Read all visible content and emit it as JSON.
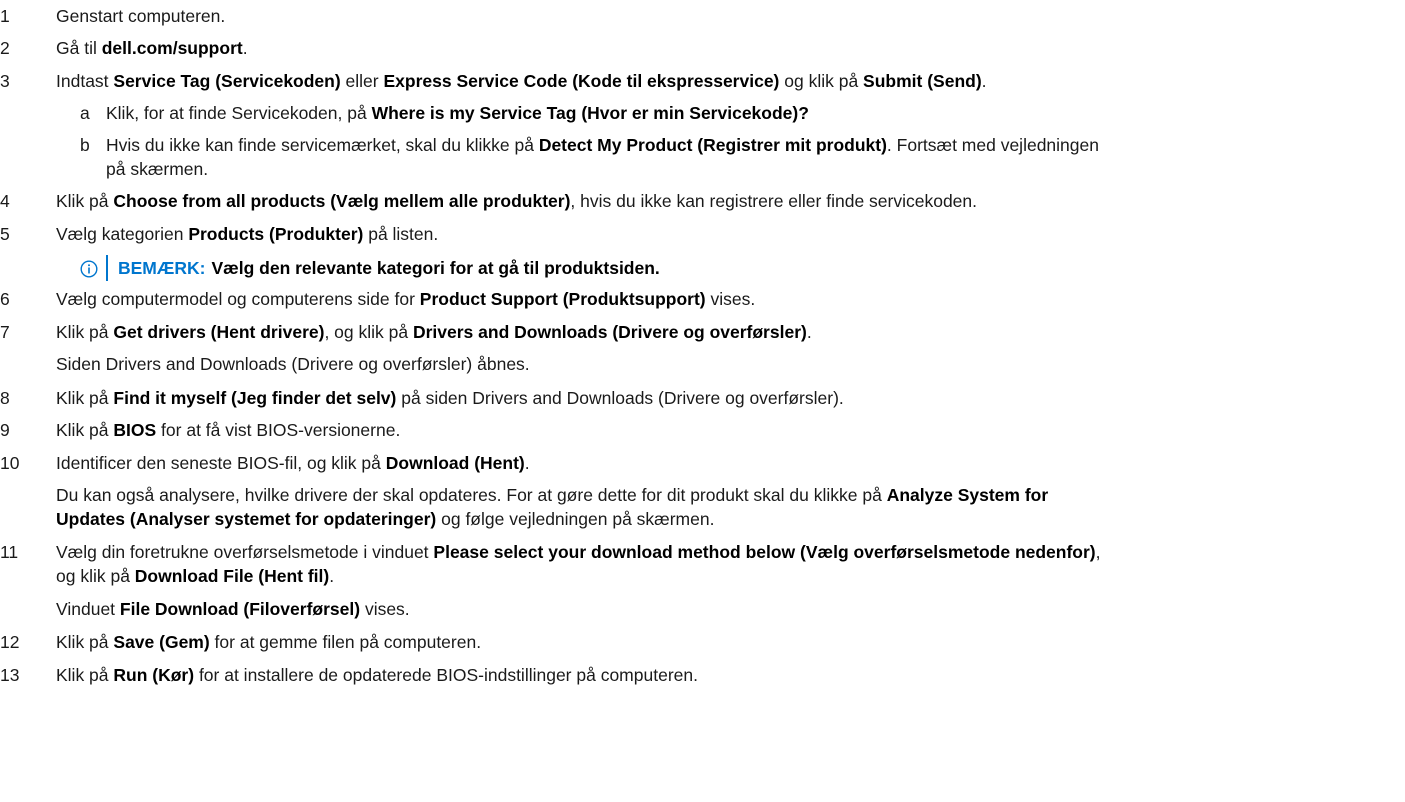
{
  "steps": [
    {
      "num": "1",
      "parts": [
        "Genstart computeren."
      ]
    },
    {
      "num": "2",
      "parts": [
        "Gå til ",
        "dell.com/support",
        "."
      ]
    },
    {
      "num": "3",
      "parts": [
        "Indtast ",
        "Service Tag (Servicekoden)",
        " eller ",
        "Express Service Code (Kode til ekspresservice)",
        " og klik på ",
        "Submit (Send)",
        "."
      ]
    },
    {
      "num": "4",
      "parts": [
        "Klik på ",
        "Choose from all products (Vælg mellem alle produkter)",
        ", hvis du ikke kan registrere eller finde servicekoden."
      ]
    },
    {
      "num": "5",
      "parts": [
        "Vælg kategorien ",
        "Products (Produkter)",
        " på listen."
      ]
    },
    {
      "num": "6",
      "parts": [
        "Vælg computermodel og computerens side for ",
        "Product Support (Produktsupport)",
        " vises."
      ]
    },
    {
      "num": "7",
      "parts": [
        "Klik på ",
        "Get drivers (Hent drivere)",
        ", og klik på ",
        "Drivers and Downloads (Drivere og overførsler)",
        "."
      ]
    },
    {
      "num": "8",
      "parts": [
        "Klik på ",
        "Find it myself (Jeg finder det selv)",
        " på siden Drivers and Downloads (Drivere og overførsler)."
      ]
    },
    {
      "num": "9",
      "parts": [
        "Klik på ",
        "BIOS",
        " for at få vist BIOS-versionerne."
      ]
    },
    {
      "num": "10",
      "parts": [
        "Identificer den seneste BIOS-fil, og klik på ",
        "Download (Hent)",
        "."
      ]
    },
    {
      "num": "11",
      "parts": [
        "Vælg din foretrukne overførselsmetode i vinduet ",
        "Please select your download method below (Vælg overførselsmetode nedenfor)",
        ","
      ]
    },
    {
      "num": "12",
      "parts": [
        "Klik på ",
        "Save (Gem)",
        " for at gemme filen på computeren."
      ]
    },
    {
      "num": "13",
      "parts": [
        "Klik på ",
        "Run (Kør)",
        " for at installere de opdaterede BIOS-indstillinger på computeren."
      ]
    }
  ],
  "substeps": [
    {
      "letter": "a",
      "parts": [
        "Klik, for at finde Servicekoden, på ",
        "Where is my Service Tag (Hvor er min Servicekode)?"
      ]
    },
    {
      "letter": "b",
      "parts": [
        "Hvis du ikke kan finde servicemærket, skal du klikke på ",
        "Detect My Product (Registrer mit produkt)",
        ". Fortsæt med vejledningen"
      ]
    }
  ],
  "continuations": [
    {
      "parts": [
        "på skærmen."
      ]
    },
    {
      "parts": [
        "Siden Drivers and Downloads (Drivere og overførsler) åbnes."
      ]
    },
    {
      "parts": [
        "Du kan også analysere, hvilke drivere der skal opdateres. For at gøre dette for dit produkt skal du klikke på ",
        "Analyze System for"
      ]
    },
    {
      "parts": [
        "Updates (Analyser systemet for opdateringer)",
        " og følge vejledningen på skærmen."
      ]
    },
    {
      "parts": [
        "og klik på ",
        "Download File (Hent fil)",
        "."
      ]
    },
    {
      "parts": [
        "Vinduet ",
        "File Download (Filoverførsel)",
        " vises."
      ]
    }
  ],
  "note": {
    "icon": "info-icon",
    "label": "BEMÆRK:",
    "text": "Vælg den relevante kategori for at gå til produktsiden."
  },
  "colors": {
    "accent": "#0076ce"
  }
}
